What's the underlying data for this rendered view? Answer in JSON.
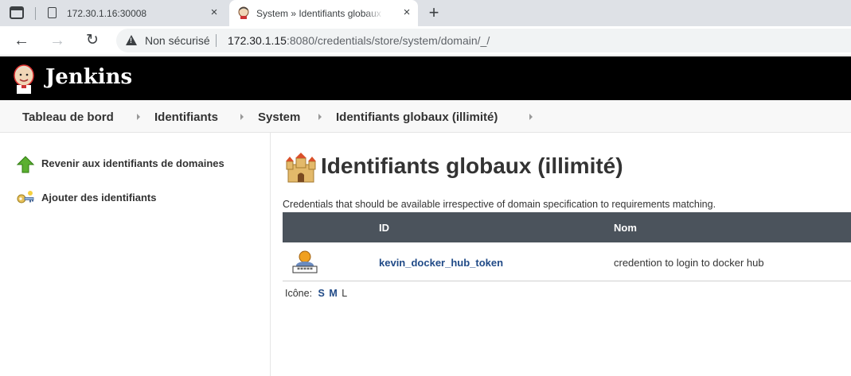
{
  "browser": {
    "tabs": [
      {
        "title": "172.30.1.16:30008",
        "active": false
      },
      {
        "title": "System » Identifiants globaux (illimité)",
        "active": true
      }
    ],
    "close_glyph": "×",
    "new_tab_glyph": "+",
    "security_label": "Non sécurisé",
    "url_host": "172.30.1.15",
    "url_rest": ":8080/credentials/store/system/domain/_/"
  },
  "header": {
    "title": "Jenkins"
  },
  "breadcrumb": [
    "Tableau de bord",
    "Identifiants",
    "System",
    "Identifiants globaux (illimité)"
  ],
  "sidepanel": {
    "tasks": [
      {
        "label": "Revenir aux identifiants de domaines",
        "icon": "up-arrow-icon"
      },
      {
        "label": "Ajouter des identifiants",
        "icon": "key-icon"
      }
    ]
  },
  "main": {
    "title": "Identifiants globaux (illimité)",
    "description": "Credentials that should be available irrespective of domain specification to requirements matching.",
    "table": {
      "headers": [
        "ID",
        "Nom"
      ],
      "rows": [
        {
          "icon": "password-credential-icon",
          "id": "kevin_docker_hub_token",
          "name": "credention to login to docker hub"
        }
      ]
    },
    "icon_size": {
      "label": "Icône:",
      "sizes": [
        "S",
        "M",
        "L"
      ],
      "current": "L"
    }
  },
  "colors": {
    "header_bg": "#000000",
    "table_header_bg": "#4b535c",
    "link": "#204a87"
  }
}
